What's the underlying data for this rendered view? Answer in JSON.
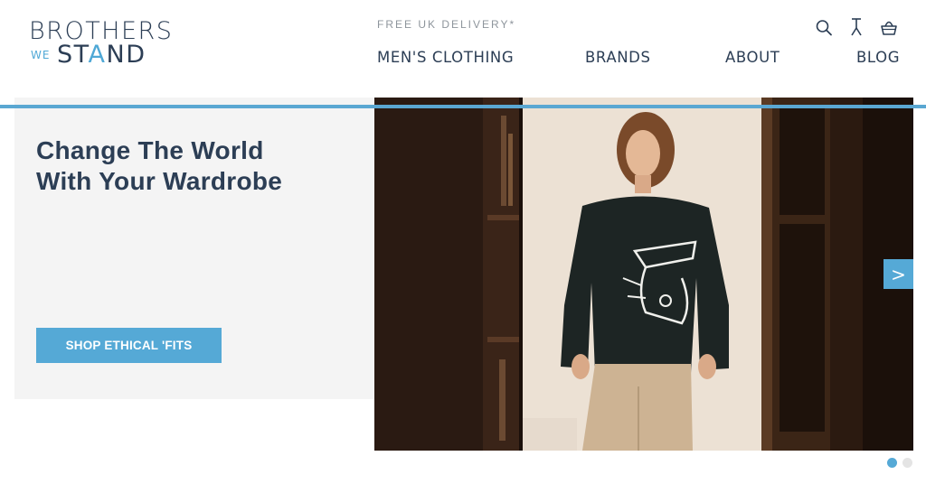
{
  "logo": {
    "line1_part1": "BROTHERS",
    "line2_we": "WE",
    "line2_part1": "ST",
    "line2_accent": "A",
    "line2_part2": "ND"
  },
  "header": {
    "delivery_text": "FREE UK DELIVERY*",
    "nav": [
      "MEN'S CLOTHING",
      "BRANDS",
      "ABOUT",
      "BLOG"
    ],
    "icons": [
      "search-icon",
      "hanger-icon",
      "basket-icon"
    ]
  },
  "hero": {
    "headline_line1": "Change The World",
    "headline_line2": "With Your Wardrobe",
    "cta_label": "SHOP ETHICAL 'FITS",
    "next_label": ">",
    "slides": {
      "total": 2,
      "active": 1
    }
  },
  "colors": {
    "brand_navy": "#2c3e55",
    "accent_blue": "#55a9d6",
    "panel_bg": "#f4f4f4"
  }
}
